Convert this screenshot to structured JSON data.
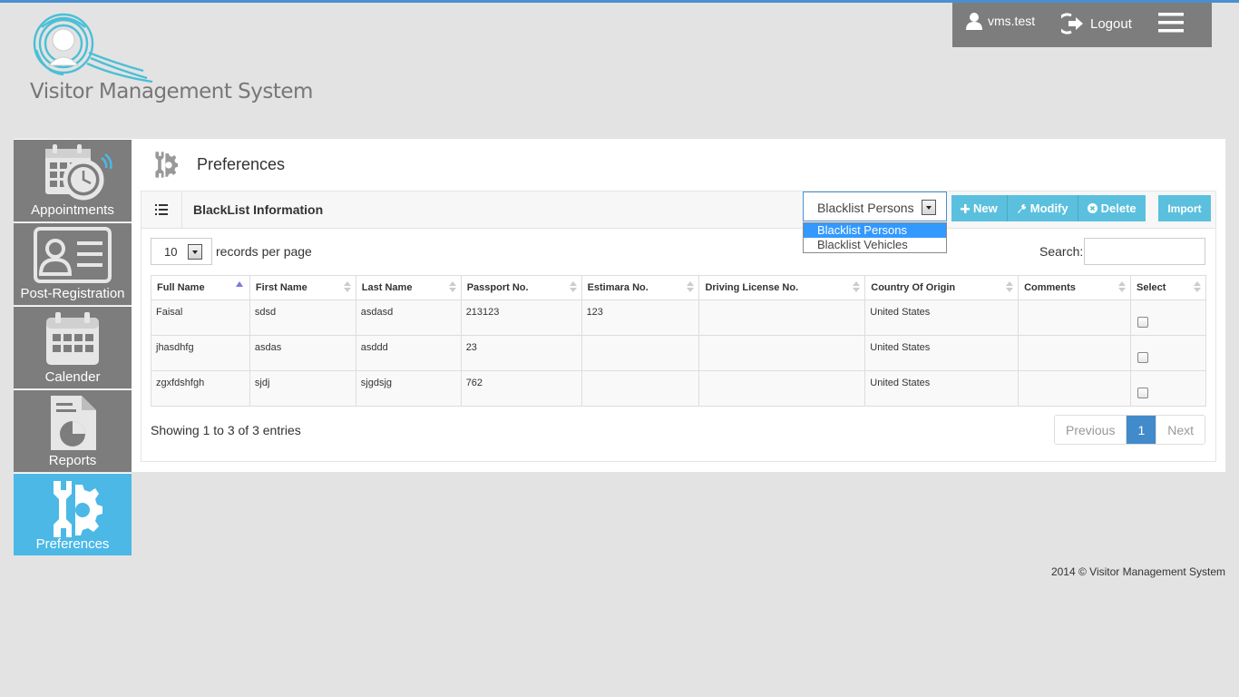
{
  "app": {
    "logo_text": "Visitor Management System"
  },
  "user_panel": {
    "username": "vms.test",
    "logout_label": "Logout"
  },
  "sidebar": {
    "items": [
      {
        "label": "Appointments",
        "icon": "calendar-clock-icon",
        "active": false
      },
      {
        "label": "Post-Registration",
        "icon": "id-card-icon",
        "active": false
      },
      {
        "label": "Calender",
        "icon": "calendar-icon",
        "active": false
      },
      {
        "label": "Reports",
        "icon": "report-icon",
        "active": false
      },
      {
        "label": "Preferences",
        "icon": "wrench-gear-icon",
        "active": true
      }
    ]
  },
  "page": {
    "title": "Preferences"
  },
  "box": {
    "title": "BlackList Information",
    "type_select": {
      "selected": "Blacklist Persons",
      "options": [
        "Blacklist Persons",
        "Blacklist Vehicles"
      ]
    },
    "buttons": {
      "new": "New",
      "modify": "Modify",
      "delete": "Delete",
      "import": "Import"
    },
    "length": {
      "value": "10",
      "label": "records per page"
    },
    "search_label": "Search:",
    "search_value": ""
  },
  "table": {
    "columns": [
      "Full Name",
      "First Name",
      "Last Name",
      "Passport No.",
      "Estimara No.",
      "Driving License No.",
      "Country Of Origin",
      "Comments",
      "Select"
    ],
    "rows": [
      [
        "Faisal",
        "sdsd",
        "asdasd",
        "213123",
        "123",
        "",
        "United States",
        ""
      ],
      [
        "jhasdhfg",
        "asdas",
        "asddd",
        "23",
        "",
        "",
        "United States",
        ""
      ],
      [
        "zgxfdshfgh",
        "sjdj",
        "sjgdsjg",
        "762",
        "",
        "",
        "United States",
        ""
      ]
    ]
  },
  "pagination": {
    "info": "Showing 1 to 3 of 3 entries",
    "previous": "Previous",
    "current": "1",
    "next": "Next"
  },
  "footer": {
    "text": "2014 © Visitor Management System"
  },
  "colors": {
    "accent": "#4bb8e6",
    "sidebar": "#7d7d7d",
    "button": "#5bc0de",
    "page_active": "#428bca"
  }
}
